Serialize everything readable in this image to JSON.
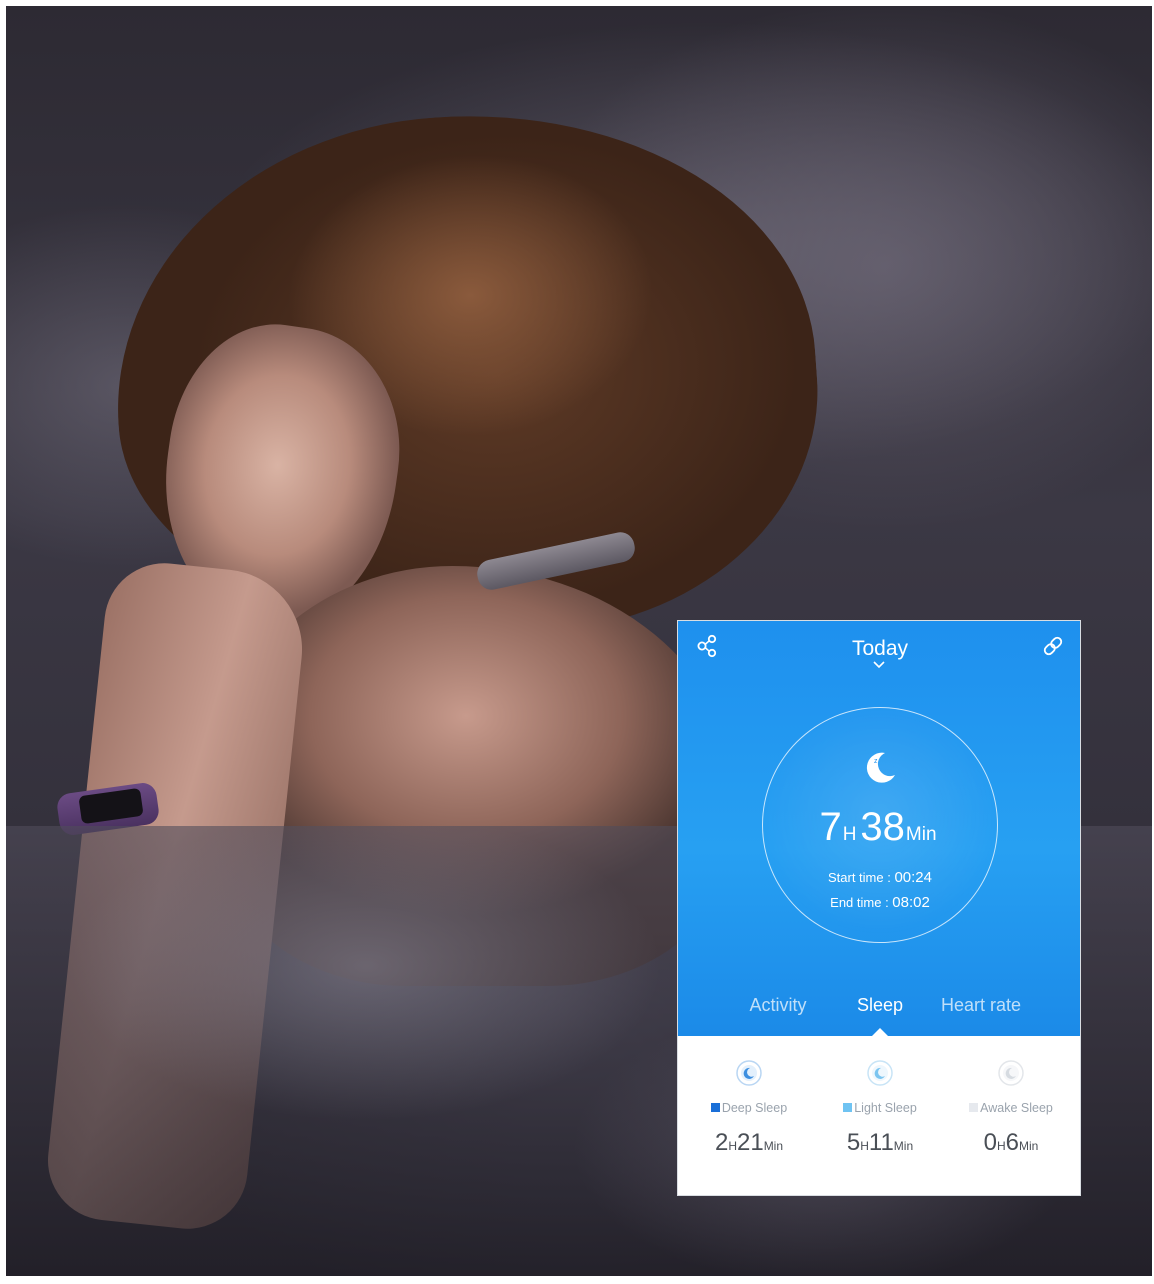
{
  "header": {
    "title": "Today"
  },
  "summary": {
    "hours": "7",
    "hours_unit": "H",
    "minutes": "38",
    "minutes_unit": "Min",
    "start_label": "Start time : ",
    "start_value": "00:24",
    "end_label": "End time : ",
    "end_value": "08:02"
  },
  "tabs": [
    {
      "label": "Activity",
      "active": false
    },
    {
      "label": "Sleep",
      "active": true
    },
    {
      "label": "Heart rate",
      "active": false
    }
  ],
  "stats": [
    {
      "label": "Deep Sleep",
      "color": "#1a6fd8",
      "icon": "deep-sleep-icon",
      "h": "2",
      "h_unit": "H",
      "m": "21",
      "m_unit": "Min"
    },
    {
      "label": "Light Sleep",
      "color": "#6fc3f2",
      "icon": "light-sleep-icon",
      "h": "5",
      "h_unit": "H",
      "m": "11",
      "m_unit": "Min"
    },
    {
      "label": "Awake Sleep",
      "color": "#e6e9ee",
      "icon": "awake-sleep-icon",
      "h": "0",
      "h_unit": "H",
      "m": "6",
      "m_unit": "Min"
    }
  ],
  "colors": {
    "accent": "#1e90ee",
    "band": "#6b4b84"
  },
  "icons": {
    "share": "share-icon",
    "link": "link-icon",
    "moon": "moon-icon",
    "chevron": "chevron-down-icon"
  }
}
